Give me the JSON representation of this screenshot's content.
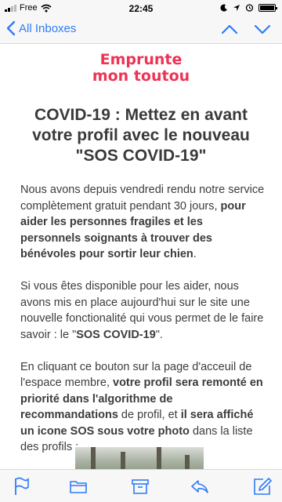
{
  "status_bar": {
    "carrier": "Free",
    "time": "22:45",
    "battery_level": 1.0
  },
  "nav": {
    "back_label": "All Inboxes"
  },
  "email": {
    "logo_line1": "Emprunte",
    "logo_line2": "mon toutou",
    "headline": "COVID-19 : Mettez en avant votre profil avec le nouveau \"SOS COVID-19\"",
    "p1_text_a": "Nous avons depuis vendredi rendu notre service complètement gratuit pendant 30 jours, ",
    "p1_bold": "pour aider les personnes fragiles et les personnels soignants à trouver des bénévoles pour sortir leur chien",
    "p1_text_b": ".",
    "p2_text_a": "Si vous êtes disponible pour les aider, nous avons mis en place aujourd'hui sur le site une nouvelle fonctionalité qui vous permet de le faire savoir : le \"",
    "p2_bold": "SOS COVID-19",
    "p2_text_b": "\".",
    "p3_text_a": "En cliquant ce bouton sur la page d'acceuil de l'espace membre, ",
    "p3_bold_a": "votre profil sera remonté en priorité dans l'algorithme de recommandations",
    "p3_text_b": " de profil, et ",
    "p3_bold_b": "il sera affiché un icone SOS sous votre photo",
    "p3_text_c": " dans la liste des profils :"
  },
  "icons": {
    "wifi": "wifi-icon",
    "moon": "moon-icon",
    "location": "location-icon",
    "alarm": "alarm-icon",
    "back": "chevron-left-icon",
    "up": "chevron-up-icon",
    "down": "chevron-down-icon",
    "flag": "flag-icon",
    "folder": "folder-icon",
    "archive": "archive-icon",
    "reply": "reply-icon",
    "compose": "compose-icon"
  },
  "colors": {
    "accent": "#2f7cf6",
    "logo": "#ee3355",
    "text": "#3c3c3c"
  }
}
